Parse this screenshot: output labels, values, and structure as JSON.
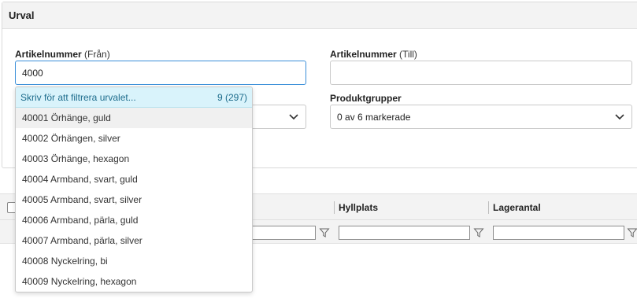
{
  "panel": {
    "title": "Urval",
    "from_label_bold": "Artikelnummer",
    "from_label_hint": "(Från)",
    "from_value": "4000",
    "to_label_bold": "Artikelnummer",
    "to_label_hint": "(Till)",
    "to_value": "",
    "productgroups_label": "Produktgrupper",
    "productgroups_value": "0 av 6 markerade"
  },
  "dropdown": {
    "filter_placeholder": "Skriv för att filtrera urvalet...",
    "count": "9 (297)",
    "items": [
      "40001 Örhänge, guld",
      "40002 Örhängen, silver",
      "40003 Örhänge, hexagon",
      "40004 Armband, svart, guld",
      "40005 Armband, svart, silver",
      "40006 Armband, pärla, guld",
      "40007 Armband, pärla, silver",
      "40008 Nyckelring, bi",
      "40009 Nyckelring, hexagon"
    ]
  },
  "grid": {
    "columns": [
      "Hyllplats",
      "Lagerantal"
    ]
  },
  "colors": {
    "accent": "#3b8fd9",
    "dropdown_header_bg": "#d9f3fb",
    "header_bg": "#f3f3f3"
  },
  "icons": {
    "select_arrow": "chevron-down-icon",
    "column_filter": "filter-icon"
  }
}
